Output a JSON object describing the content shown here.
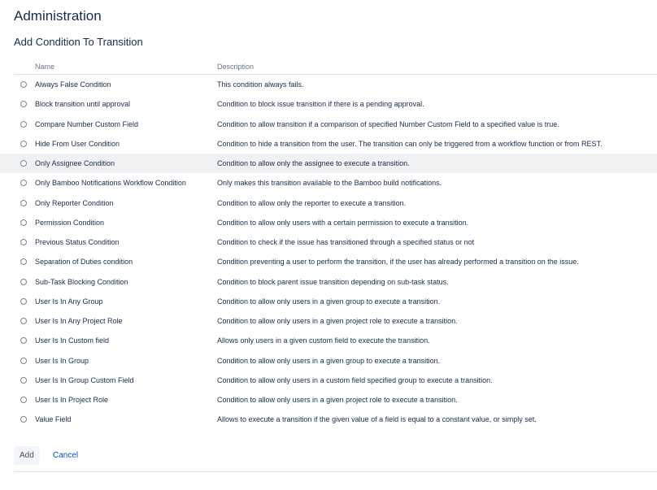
{
  "header": {
    "title": "Administration",
    "subtitle": "Add Condition To Transition"
  },
  "table": {
    "columns": {
      "name": "Name",
      "description": "Description"
    },
    "highlighted_row": 4,
    "rows": [
      {
        "name": "Always False Condition",
        "description": "This condition always fails."
      },
      {
        "name": "Block transition until approval",
        "description": "Condition to block issue transition if there is a pending approval."
      },
      {
        "name": "Compare Number Custom Field",
        "description": "Condition to allow transition if a comparison of specified Number Custom Field to a specified value is true."
      },
      {
        "name": "Hide From User Condition",
        "description": "Condition to hide a transition from the user. The transition can only be triggered from a workflow function or from REST."
      },
      {
        "name": "Only Assignee Condition",
        "description": "Condition to allow only the assignee to execute a transition."
      },
      {
        "name": "Only Bamboo Notifications Workflow Condition",
        "description": "Only makes this transition available to the Bamboo build notifications."
      },
      {
        "name": "Only Reporter Condition",
        "description": "Condition to allow only the reporter to execute a transition."
      },
      {
        "name": "Permission Condition",
        "description": "Condition to allow only users with a certain permission to execute a transition."
      },
      {
        "name": "Previous Status Condition",
        "description": "Condition to check if the issue has transitioned through a specified status or not"
      },
      {
        "name": "Separation of Duties condition",
        "description": "Condition preventing a user to perform the transition, if the user has already performed a transition on the issue."
      },
      {
        "name": "Sub-Task Blocking Condition",
        "description": "Condition to block parent issue transition depending on sub-task status."
      },
      {
        "name": "User Is In Any Group",
        "description": "Condition to allow only users in a given group to execute a transition."
      },
      {
        "name": "User Is In Any Project Role",
        "description": "Condition to allow only users in a given project role to execute a transition."
      },
      {
        "name": "User Is In Custom field",
        "description": "Allows only users in a given custom field to execute the transition."
      },
      {
        "name": "User Is In Group",
        "description": "Condition to allow only users in a given group to execute a transition."
      },
      {
        "name": "User Is In Group Custom Field",
        "description": "Condition to allow only users in a custom field specified group to execute a transition."
      },
      {
        "name": "User Is In Project Role",
        "description": "Condition to allow only users in a given project role to execute a transition."
      },
      {
        "name": "Value Field",
        "description": "Allows to execute a transition if the given value of a field is equal to a constant value, or simply set."
      }
    ]
  },
  "actions": {
    "add_label": "Add",
    "cancel_label": "Cancel"
  },
  "colors": {
    "text": "#172b4d",
    "muted": "#6b778c",
    "link": "#0052cc",
    "highlight": "#f0f1f3"
  }
}
